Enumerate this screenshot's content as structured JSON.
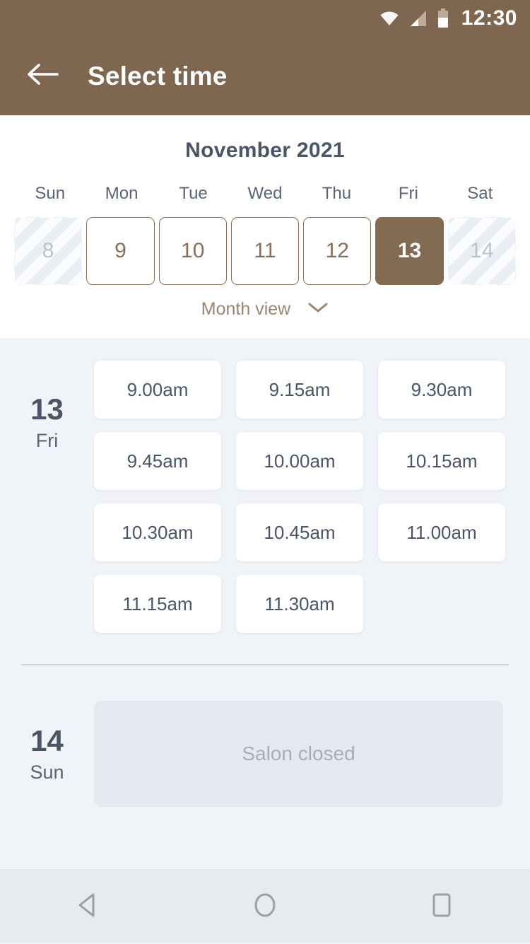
{
  "status_bar": {
    "time": "12:30",
    "icons": [
      "wifi-icon",
      "signal-icon",
      "battery-icon"
    ]
  },
  "app_bar": {
    "back_icon": "back-arrow-icon",
    "title": "Select time"
  },
  "calendar": {
    "month_label": "November 2021",
    "weekdays": [
      "Sun",
      "Mon",
      "Tue",
      "Wed",
      "Thu",
      "Fri",
      "Sat"
    ],
    "days": [
      {
        "number": "8",
        "state": "disabled"
      },
      {
        "number": "9",
        "state": "available"
      },
      {
        "number": "10",
        "state": "available"
      },
      {
        "number": "11",
        "state": "available"
      },
      {
        "number": "12",
        "state": "available"
      },
      {
        "number": "13",
        "state": "selected"
      },
      {
        "number": "14",
        "state": "disabled"
      }
    ],
    "month_view_label": "Month view",
    "month_view_icon": "chevron-down-icon"
  },
  "schedule": [
    {
      "day_number": "13",
      "day_name": "Fri",
      "slots": [
        "9.00am",
        "9.15am",
        "9.30am",
        "9.45am",
        "10.00am",
        "10.15am",
        "10.30am",
        "10.45am",
        "11.00am",
        "11.15am",
        "11.30am"
      ]
    },
    {
      "day_number": "14",
      "day_name": "Sun",
      "closed_label": "Salon closed"
    }
  ],
  "nav_bar": {
    "back_icon": "nav-back-triangle-icon",
    "home_icon": "nav-home-circle-icon",
    "recents_icon": "nav-recents-square-icon"
  },
  "colors": {
    "brand_brown": "#7E6651",
    "selected_brown": "#836A52",
    "day_border_brown": "#8A6F58",
    "slate_text": "#4A5568",
    "panel_bg": "#F0F3F7",
    "closed_bg": "#E5E9EF"
  }
}
